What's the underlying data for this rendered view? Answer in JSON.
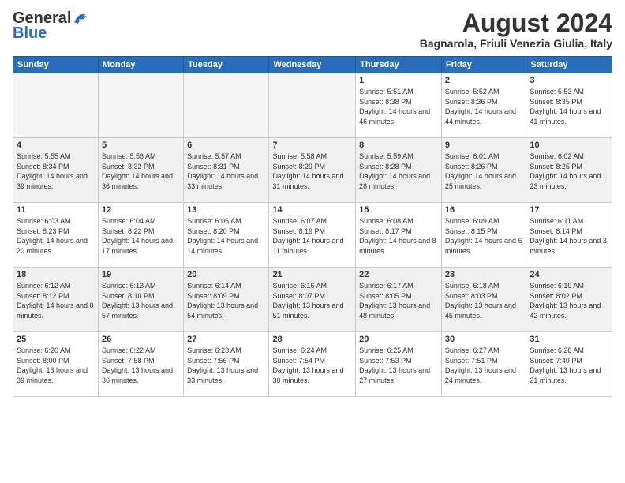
{
  "logo": {
    "line1": "General",
    "line2": "Blue"
  },
  "title": "August 2024",
  "subtitle": "Bagnarola, Friuli Venezia Giulia, Italy",
  "days_of_week": [
    "Sunday",
    "Monday",
    "Tuesday",
    "Wednesday",
    "Thursday",
    "Friday",
    "Saturday"
  ],
  "weeks": [
    [
      {
        "day": "",
        "info": ""
      },
      {
        "day": "",
        "info": ""
      },
      {
        "day": "",
        "info": ""
      },
      {
        "day": "",
        "info": ""
      },
      {
        "day": "1",
        "info": "Sunrise: 5:51 AM\nSunset: 8:38 PM\nDaylight: 14 hours and 46 minutes."
      },
      {
        "day": "2",
        "info": "Sunrise: 5:52 AM\nSunset: 8:36 PM\nDaylight: 14 hours and 44 minutes."
      },
      {
        "day": "3",
        "info": "Sunrise: 5:53 AM\nSunset: 8:35 PM\nDaylight: 14 hours and 41 minutes."
      }
    ],
    [
      {
        "day": "4",
        "info": "Sunrise: 5:55 AM\nSunset: 8:34 PM\nDaylight: 14 hours and 39 minutes."
      },
      {
        "day": "5",
        "info": "Sunrise: 5:56 AM\nSunset: 8:32 PM\nDaylight: 14 hours and 36 minutes."
      },
      {
        "day": "6",
        "info": "Sunrise: 5:57 AM\nSunset: 8:31 PM\nDaylight: 14 hours and 33 minutes."
      },
      {
        "day": "7",
        "info": "Sunrise: 5:58 AM\nSunset: 8:29 PM\nDaylight: 14 hours and 31 minutes."
      },
      {
        "day": "8",
        "info": "Sunrise: 5:59 AM\nSunset: 8:28 PM\nDaylight: 14 hours and 28 minutes."
      },
      {
        "day": "9",
        "info": "Sunrise: 6:01 AM\nSunset: 8:26 PM\nDaylight: 14 hours and 25 minutes."
      },
      {
        "day": "10",
        "info": "Sunrise: 6:02 AM\nSunset: 8:25 PM\nDaylight: 14 hours and 23 minutes."
      }
    ],
    [
      {
        "day": "11",
        "info": "Sunrise: 6:03 AM\nSunset: 8:23 PM\nDaylight: 14 hours and 20 minutes."
      },
      {
        "day": "12",
        "info": "Sunrise: 6:04 AM\nSunset: 8:22 PM\nDaylight: 14 hours and 17 minutes."
      },
      {
        "day": "13",
        "info": "Sunrise: 6:06 AM\nSunset: 8:20 PM\nDaylight: 14 hours and 14 minutes."
      },
      {
        "day": "14",
        "info": "Sunrise: 6:07 AM\nSunset: 8:19 PM\nDaylight: 14 hours and 11 minutes."
      },
      {
        "day": "15",
        "info": "Sunrise: 6:08 AM\nSunset: 8:17 PM\nDaylight: 14 hours and 8 minutes."
      },
      {
        "day": "16",
        "info": "Sunrise: 6:09 AM\nSunset: 8:15 PM\nDaylight: 14 hours and 6 minutes."
      },
      {
        "day": "17",
        "info": "Sunrise: 6:11 AM\nSunset: 8:14 PM\nDaylight: 14 hours and 3 minutes."
      }
    ],
    [
      {
        "day": "18",
        "info": "Sunrise: 6:12 AM\nSunset: 8:12 PM\nDaylight: 14 hours and 0 minutes."
      },
      {
        "day": "19",
        "info": "Sunrise: 6:13 AM\nSunset: 8:10 PM\nDaylight: 13 hours and 57 minutes."
      },
      {
        "day": "20",
        "info": "Sunrise: 6:14 AM\nSunset: 8:09 PM\nDaylight: 13 hours and 54 minutes."
      },
      {
        "day": "21",
        "info": "Sunrise: 6:16 AM\nSunset: 8:07 PM\nDaylight: 13 hours and 51 minutes."
      },
      {
        "day": "22",
        "info": "Sunrise: 6:17 AM\nSunset: 8:05 PM\nDaylight: 13 hours and 48 minutes."
      },
      {
        "day": "23",
        "info": "Sunrise: 6:18 AM\nSunset: 8:03 PM\nDaylight: 13 hours and 45 minutes."
      },
      {
        "day": "24",
        "info": "Sunrise: 6:19 AM\nSunset: 8:02 PM\nDaylight: 13 hours and 42 minutes."
      }
    ],
    [
      {
        "day": "25",
        "info": "Sunrise: 6:20 AM\nSunset: 8:00 PM\nDaylight: 13 hours and 39 minutes."
      },
      {
        "day": "26",
        "info": "Sunrise: 6:22 AM\nSunset: 7:58 PM\nDaylight: 13 hours and 36 minutes."
      },
      {
        "day": "27",
        "info": "Sunrise: 6:23 AM\nSunset: 7:56 PM\nDaylight: 13 hours and 33 minutes."
      },
      {
        "day": "28",
        "info": "Sunrise: 6:24 AM\nSunset: 7:54 PM\nDaylight: 13 hours and 30 minutes."
      },
      {
        "day": "29",
        "info": "Sunrise: 6:25 AM\nSunset: 7:53 PM\nDaylight: 13 hours and 27 minutes."
      },
      {
        "day": "30",
        "info": "Sunrise: 6:27 AM\nSunset: 7:51 PM\nDaylight: 13 hours and 24 minutes."
      },
      {
        "day": "31",
        "info": "Sunrise: 6:28 AM\nSunset: 7:49 PM\nDaylight: 13 hours and 21 minutes."
      }
    ]
  ]
}
